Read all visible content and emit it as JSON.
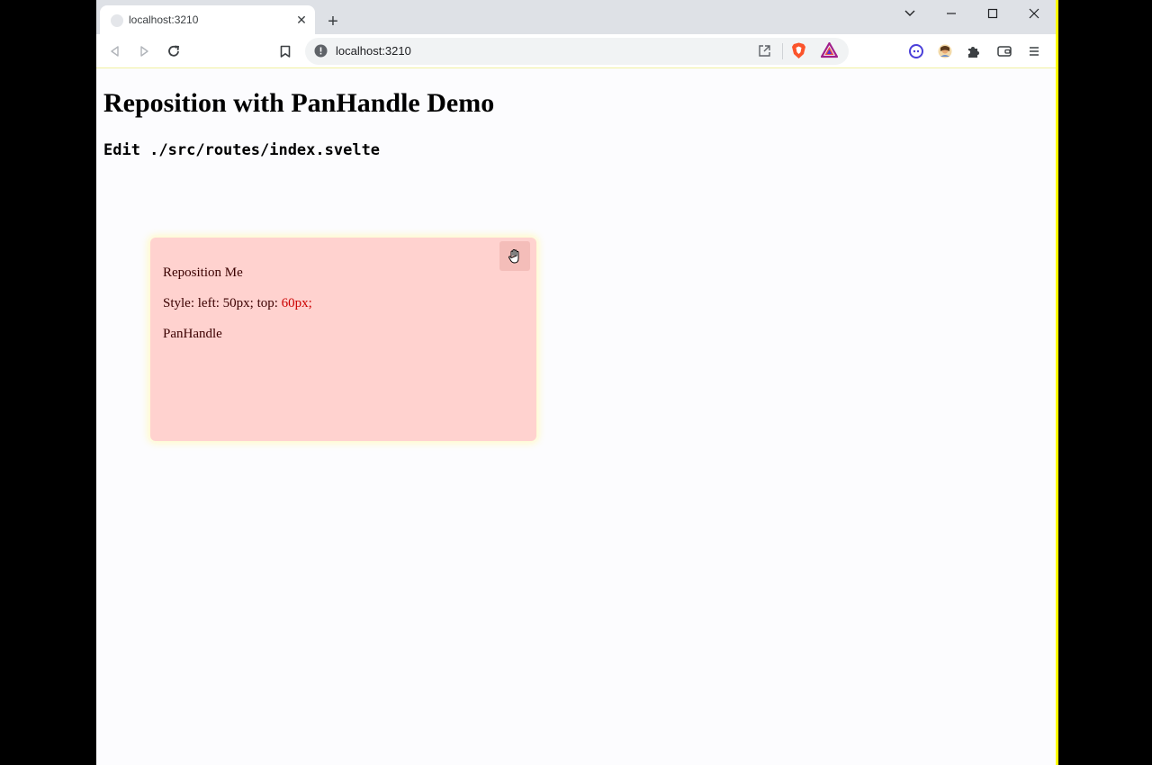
{
  "browser": {
    "tab_title": "localhost:3210",
    "url": "localhost:3210",
    "new_tab_label": "+",
    "tab_close_label": "✕"
  },
  "page": {
    "title": "Reposition with PanHandle Demo",
    "subtitle": "Edit ./src/routes/index.svelte"
  },
  "card": {
    "heading": "Reposition Me",
    "style_prefix": "Style: left: 50px; top: ",
    "style_top_value": "60px;",
    "handle_label": "PanHandle"
  },
  "colors": {
    "card_background": "#ffd2cf",
    "handle_background": "#f4bdb9",
    "top_value_color": "#cc0000",
    "brave_orange": "#fb542b"
  },
  "icons": [
    "back-icon",
    "forward-icon",
    "reload-icon",
    "bookmark-icon",
    "site-info-icon",
    "share-icon",
    "brave-shields-icon",
    "brave-rewards-icon",
    "extension-icon",
    "avatar-icon",
    "puzzle-icon",
    "wallet-icon",
    "menu-icon",
    "pan-hand-icon"
  ]
}
